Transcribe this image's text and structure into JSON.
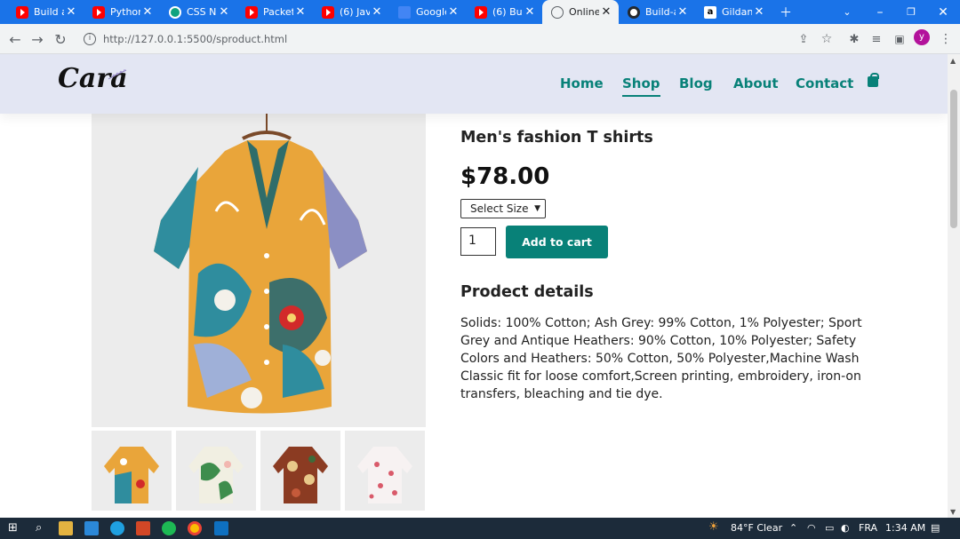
{
  "browser": {
    "tabs": [
      {
        "title": "Build an",
        "icon": "youtube-icon"
      },
      {
        "title": "Python",
        "icon": "youtube-icon"
      },
      {
        "title": "CSS Not",
        "icon": "chatgpt-icon"
      },
      {
        "title": "Packet T",
        "icon": "youtube-icon"
      },
      {
        "title": "(6) JavaS",
        "icon": "youtube-icon"
      },
      {
        "title": "Google",
        "icon": "google-translate-icon"
      },
      {
        "title": "(6) Build",
        "icon": "youtube-icon"
      },
      {
        "title": "Online S",
        "icon": "globe-icon"
      },
      {
        "title": "Build-a",
        "icon": "github-icon"
      },
      {
        "title": "Gildan A",
        "icon": "amazon-icon"
      }
    ],
    "url": "http://127.0.0.1:5500/sproduct.html",
    "profile_initial": "y"
  },
  "site": {
    "logo": "Cara",
    "nav": [
      "Home",
      "Shop",
      "Blog",
      "About",
      "Contact"
    ],
    "active_nav": "Shop",
    "accent_color": "#088178"
  },
  "product": {
    "title": "Men's fashion T shirts",
    "price": "$78.00",
    "size_select": "Select Size",
    "quantity": "1",
    "add_to_cart": "Add to cart",
    "details_heading": "Prodect details",
    "details_text": "Solids: 100% Cotton; Ash Grey: 99% Cotton, 1% Polyester; Sport Grey and Antique Heathers: 90% Cotton, 10% Polyester; Safety Colors and Heathers: 50% Cotton, 50% Polyester,Machine Wash Classic fit for loose comfort,Screen printing, embroidery, iron-on transfers, bleaching and tie dye."
  },
  "taskbar": {
    "weather": "84°F Clear",
    "language": "FRA",
    "time": "1:34 AM"
  }
}
